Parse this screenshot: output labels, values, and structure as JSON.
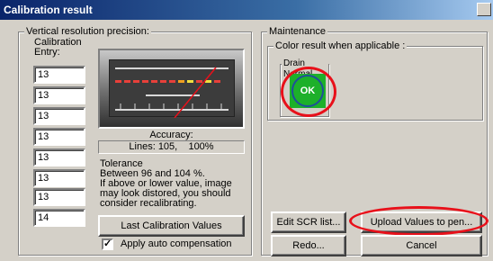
{
  "window": {
    "title": "Calibration result"
  },
  "left_group": {
    "legend": "Vertical resolution precision:",
    "entry_label": "Calibration Entry:",
    "entries": [
      "13",
      "13",
      "13",
      "13",
      "13",
      "13",
      "13",
      "14"
    ],
    "accuracy_label": "Accuracy:",
    "accuracy_value": "Lines: 105,    100%",
    "tolerance_lines": [
      "Tolerance",
      "Between 96 and 104 %.",
      "If above or lower value, image",
      "may look distored, you should",
      "consider recalibrating."
    ],
    "last_values_button": "Last Calibration Values",
    "auto_comp_label": "Apply auto compensation",
    "auto_comp_checked": true
  },
  "right_group": {
    "legend": "Maintenance",
    "color_result": {
      "legend": "Color result when applicable :",
      "sublegend": "Drain Normal",
      "status": "OK",
      "status_color": "#1db02a",
      "circle_color": "#1f4f9a"
    },
    "edit_button": "Edit SCR list...",
    "upload_button": "Upload Values to pen...",
    "redo_button": "Redo...",
    "cancel_button": "Cancel"
  },
  "colors": {
    "highlight_ellipse": "#e8101a",
    "title_bar": "#0a246a"
  }
}
